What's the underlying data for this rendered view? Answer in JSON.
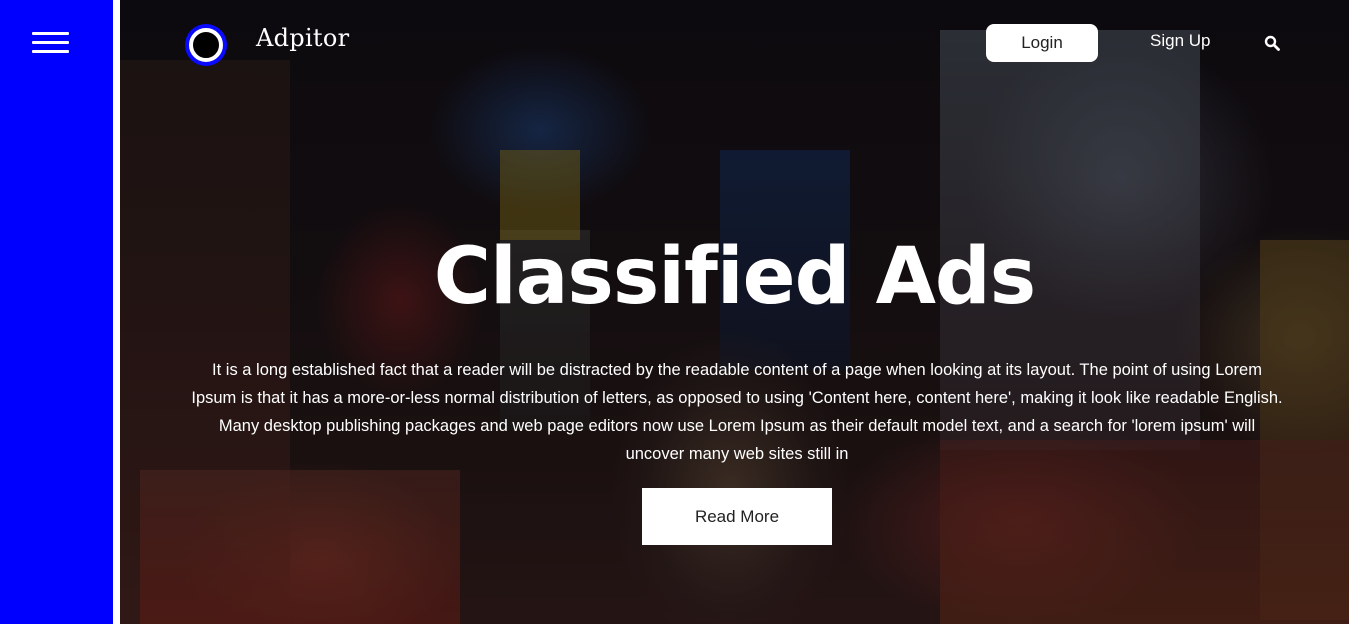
{
  "header": {
    "brand": "Adpitor",
    "login_label": "Login",
    "signup_label": "Sign Up",
    "icons": {
      "menu": "hamburger-menu-icon",
      "logo": "ring-logo-icon",
      "search": "search-icon"
    }
  },
  "hero": {
    "title": "Classified Ads",
    "text": "It is a long established fact that a reader will be distracted by the readable content of a page when looking at its layout. The point of using Lorem Ipsum is that it has a more-or-less normal distribution of letters, as opposed to using 'Content here, content here', making it look like readable English. Many desktop publishing packages and web page editors now use Lorem Ipsum as their default model text, and a search for 'lorem ipsum' will uncover many web sites still in",
    "read_more_label": "Read More"
  },
  "colors": {
    "sidebar": "#0000ff",
    "logo_accent": "#0a0aff",
    "button_bg": "#ffffff",
    "text": "#ffffff"
  }
}
